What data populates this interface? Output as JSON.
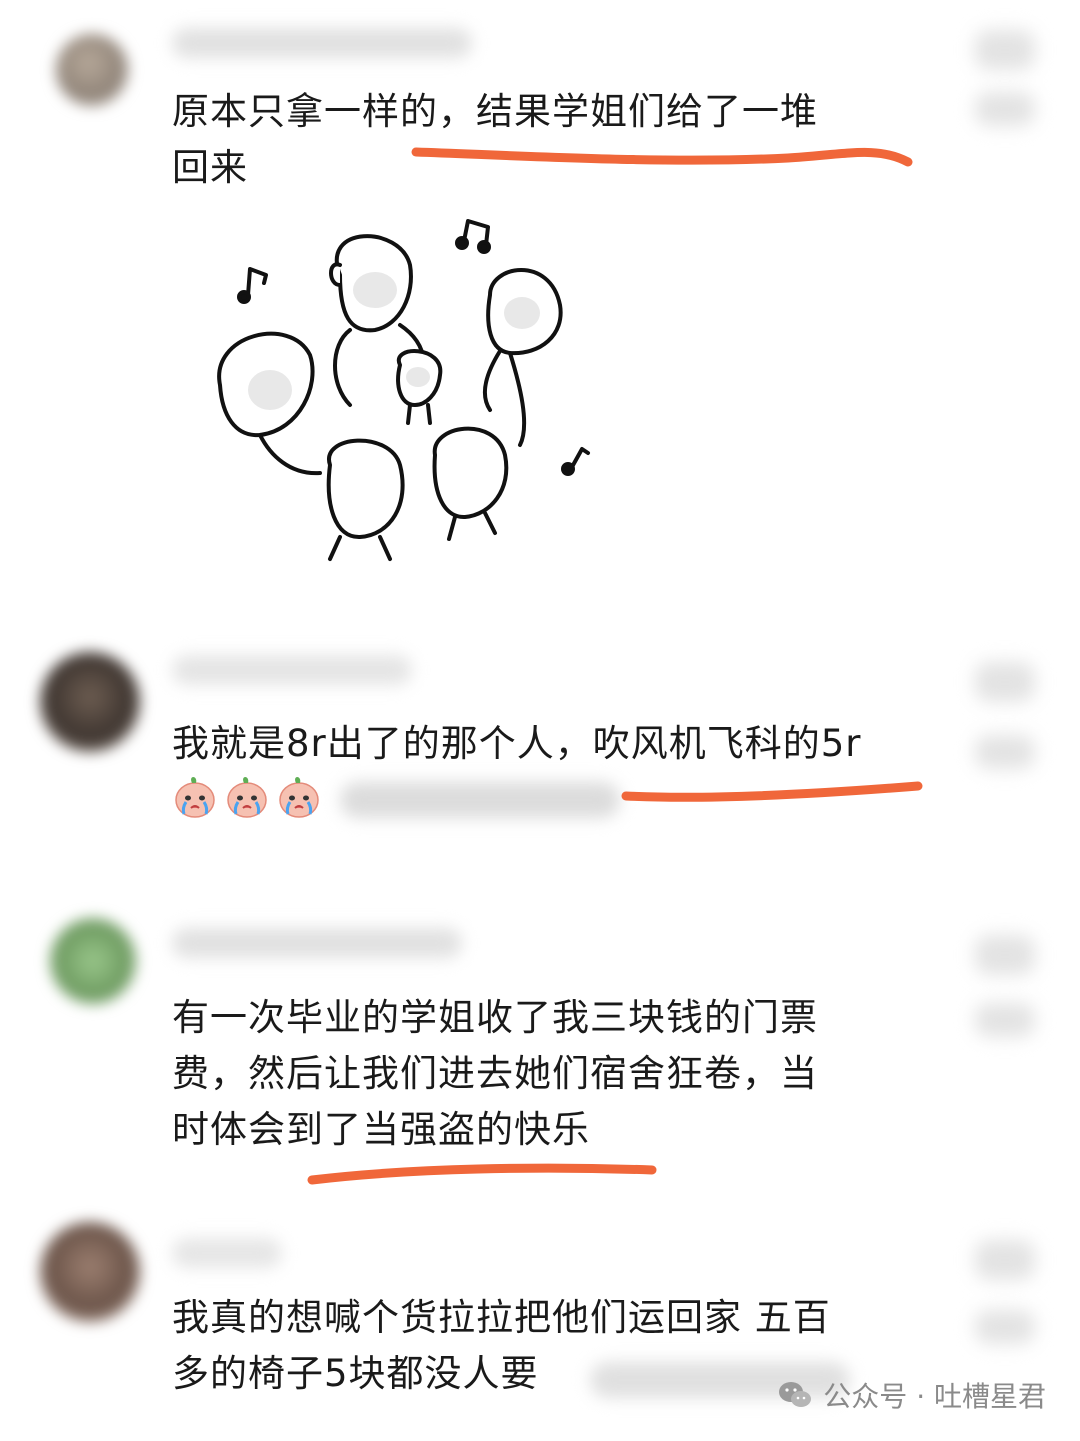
{
  "comments": [
    {
      "text": "原本只拿一样的，结果学姐们给了一堆\n回来"
    },
    {
      "text": "我就是8r出了的那个人，吹风机飞科的5r"
    },
    {
      "text": "有一次毕业的学姐收了我三块钱的门票\n费，然后让我们进去她们宿舍狂卷，当\n时体会到了当强盗的快乐"
    },
    {
      "text": "我真的想喊个货拉拉把他们运回家 五百\n多的椅子5块都没人要"
    }
  ],
  "watermark": {
    "icon": "wechat-icon",
    "label": "公众号 · 吐槽星君"
  },
  "colors": {
    "underline": "#f0673a",
    "text": "#1a1a1a"
  }
}
